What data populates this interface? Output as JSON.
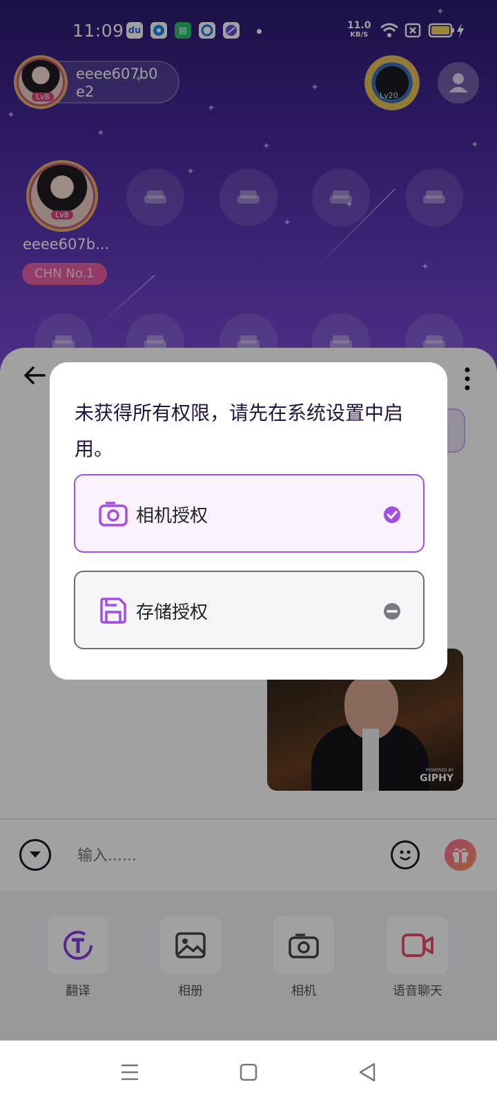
{
  "status_bar": {
    "time": "11:09",
    "net_speed": "11.0",
    "net_speed_unit": "KB/S",
    "icons": [
      "baidu-app-icon",
      "blue-app-icon",
      "green-app-icon",
      "browser-app-icon",
      "purple-app-icon",
      "wifi-icon",
      "sim-off-icon",
      "battery-icon",
      "charging-icon"
    ]
  },
  "room": {
    "host_name": "eeee607b0e2",
    "host_level": "Lv8",
    "room_level": "Lv20",
    "seat_user": {
      "name": "eeee607b...",
      "level": "Lv8",
      "rank_badge": "CHN No.1"
    }
  },
  "chat": {
    "gif_watermark": "GIPHY",
    "gif_watermark_sub": "POWERED BY",
    "input_placeholder": "输入......"
  },
  "tools": [
    {
      "label": "翻译",
      "icon": "translate-icon",
      "color": "#8a3ce0"
    },
    {
      "label": "相册",
      "icon": "album-icon",
      "color": "#444"
    },
    {
      "label": "相机",
      "icon": "camera-icon",
      "color": "#444"
    },
    {
      "label": "语音聊天",
      "icon": "video-call-icon",
      "color": "#f0506e"
    }
  ],
  "dialog": {
    "message": "未获得所有权限，请先在系统设置中启用。",
    "permissions": [
      {
        "label": "相机授权",
        "icon": "camera-icon",
        "state": "granted"
      },
      {
        "label": "存储授权",
        "icon": "save-icon",
        "state": "denied"
      }
    ]
  },
  "colors": {
    "accent": "#a24ee4",
    "room_gradient_top": "#2e1a6e",
    "room_gradient_bottom": "#7b4bd6",
    "rank_badge": "#e85fa4"
  }
}
